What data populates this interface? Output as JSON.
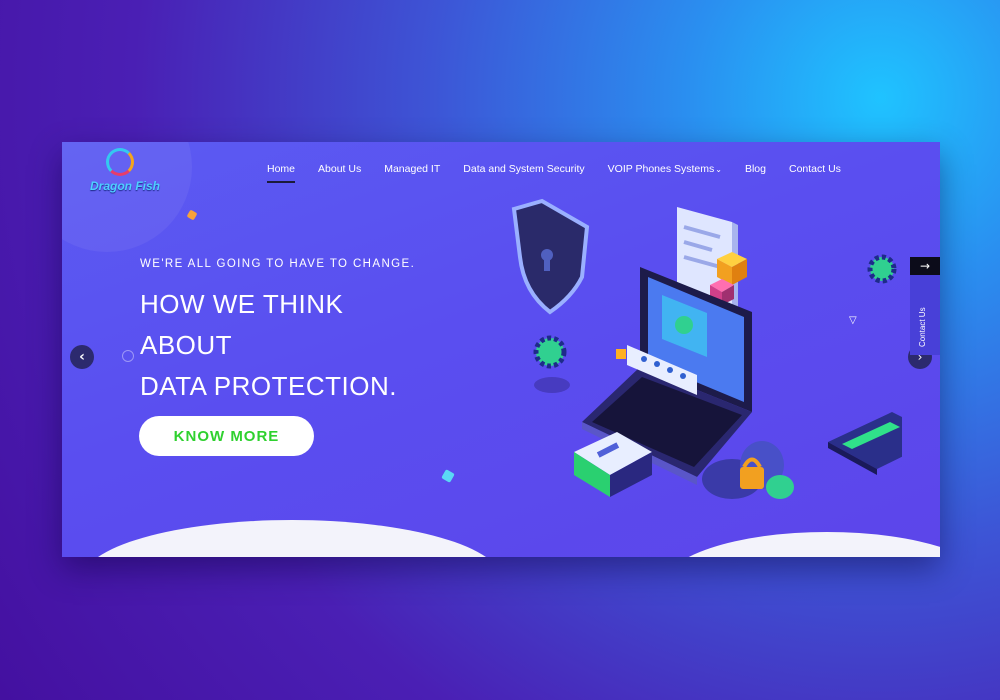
{
  "brand": {
    "logo_text": "Dragon Fish"
  },
  "nav": {
    "items": [
      {
        "label": "Home",
        "active": true
      },
      {
        "label": "About Us"
      },
      {
        "label": "Managed IT"
      },
      {
        "label": "Data and System Security"
      },
      {
        "label": "VOIP Phones Systems",
        "has_dropdown": true
      },
      {
        "label": "Blog"
      },
      {
        "label": "Contact Us"
      }
    ]
  },
  "hero": {
    "eyebrow": "WE'RE ALL GOING TO HAVE TO CHANGE.",
    "headline_lines": [
      "HOW WE THINK",
      "ABOUT",
      "DATA PROTECTION."
    ],
    "cta_label": "KNOW MORE"
  },
  "slider": {
    "prev_icon": "chevron-left-icon",
    "next_icon": "chevron-right-icon"
  },
  "side_tab": {
    "arrow": "→",
    "label": "Contact Us"
  },
  "colors": {
    "accent_green": "#2fd12f",
    "hero_purple": "#5a4ef0",
    "page_bg_dark": "#4410a0",
    "page_bg_light": "#1fc3ff"
  }
}
